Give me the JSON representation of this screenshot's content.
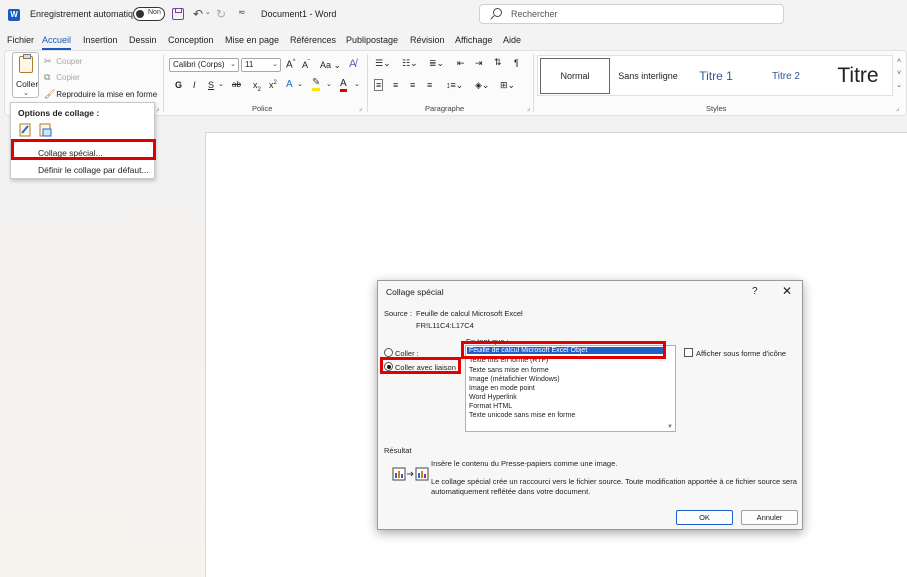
{
  "titlebar": {
    "logo_letter": "W",
    "autosave_label": "Enregistrement automatique",
    "autosave_state": "Non",
    "doc_title": "Document1 - Word",
    "search_placeholder": "Rechercher"
  },
  "tabs": [
    "Fichier",
    "Accueil",
    "Insertion",
    "Dessin",
    "Conception",
    "Mise en page",
    "Références",
    "Publipostage",
    "Révision",
    "Affichage",
    "Aide"
  ],
  "ribbon": {
    "clipboard": {
      "paste_label": "Coller",
      "cut_label": "Couper",
      "copy_label": "Copier",
      "format_painter_label": "Reproduire la mise en forme"
    },
    "font": {
      "group_label": "Police",
      "font_name": "Calibri (Corps)",
      "font_size": "11",
      "grow": "A",
      "shrink": "A",
      "change_case": "Aa",
      "bold": "G",
      "italic": "I",
      "underline": "S",
      "strike": "ab",
      "subscript": "x",
      "superscript": "x",
      "font_color": "A"
    },
    "paragraph": {
      "group_label": "Paragraphe",
      "show_marks": "¶"
    },
    "styles": {
      "group_label": "Styles",
      "items": [
        "Normal",
        "Sans interligne",
        "Titre 1",
        "Titre 2",
        "Titre"
      ]
    }
  },
  "paste_menu": {
    "title": "Options de collage :",
    "item_special": "Collage spécial...",
    "item_default": "Définir le collage par défaut..."
  },
  "dialog": {
    "title": "Collage spécial",
    "help": "?",
    "close": "✕",
    "source_label": "Source :",
    "source_value": "Feuille de calcul Microsoft Excel",
    "source_ref": "FR!L11C4:L17C4",
    "as_label": "En tant que :",
    "radio_paste": "Coller :",
    "radio_link": "Coller avec liaison :",
    "list": [
      "Feuille de calcul Microsoft Excel Objet",
      "Texte mis en forme (RTF)",
      "Texte sans mise en forme",
      "Image (métafichier Windows)",
      "Image en mode point",
      "Word Hyperlink",
      "Format HTML",
      "Texte unicode sans mise en forme"
    ],
    "show_icon_label": "Afficher sous forme d'icône",
    "result_label": "Résultat",
    "result_line1": "Insère le contenu du Presse-papiers comme une image.",
    "result_line2": "Le collage spécial crée un raccourci vers le fichier source. Toute modification apportée à ce fichier source sera",
    "result_line3": "automatiquement reflétée dans votre document.",
    "ok_label": "OK",
    "cancel_label": "Annuler"
  },
  "colors": {
    "accent": "#185abd",
    "highlight_red": "#e00000",
    "list_selection": "#1e5fc8"
  }
}
